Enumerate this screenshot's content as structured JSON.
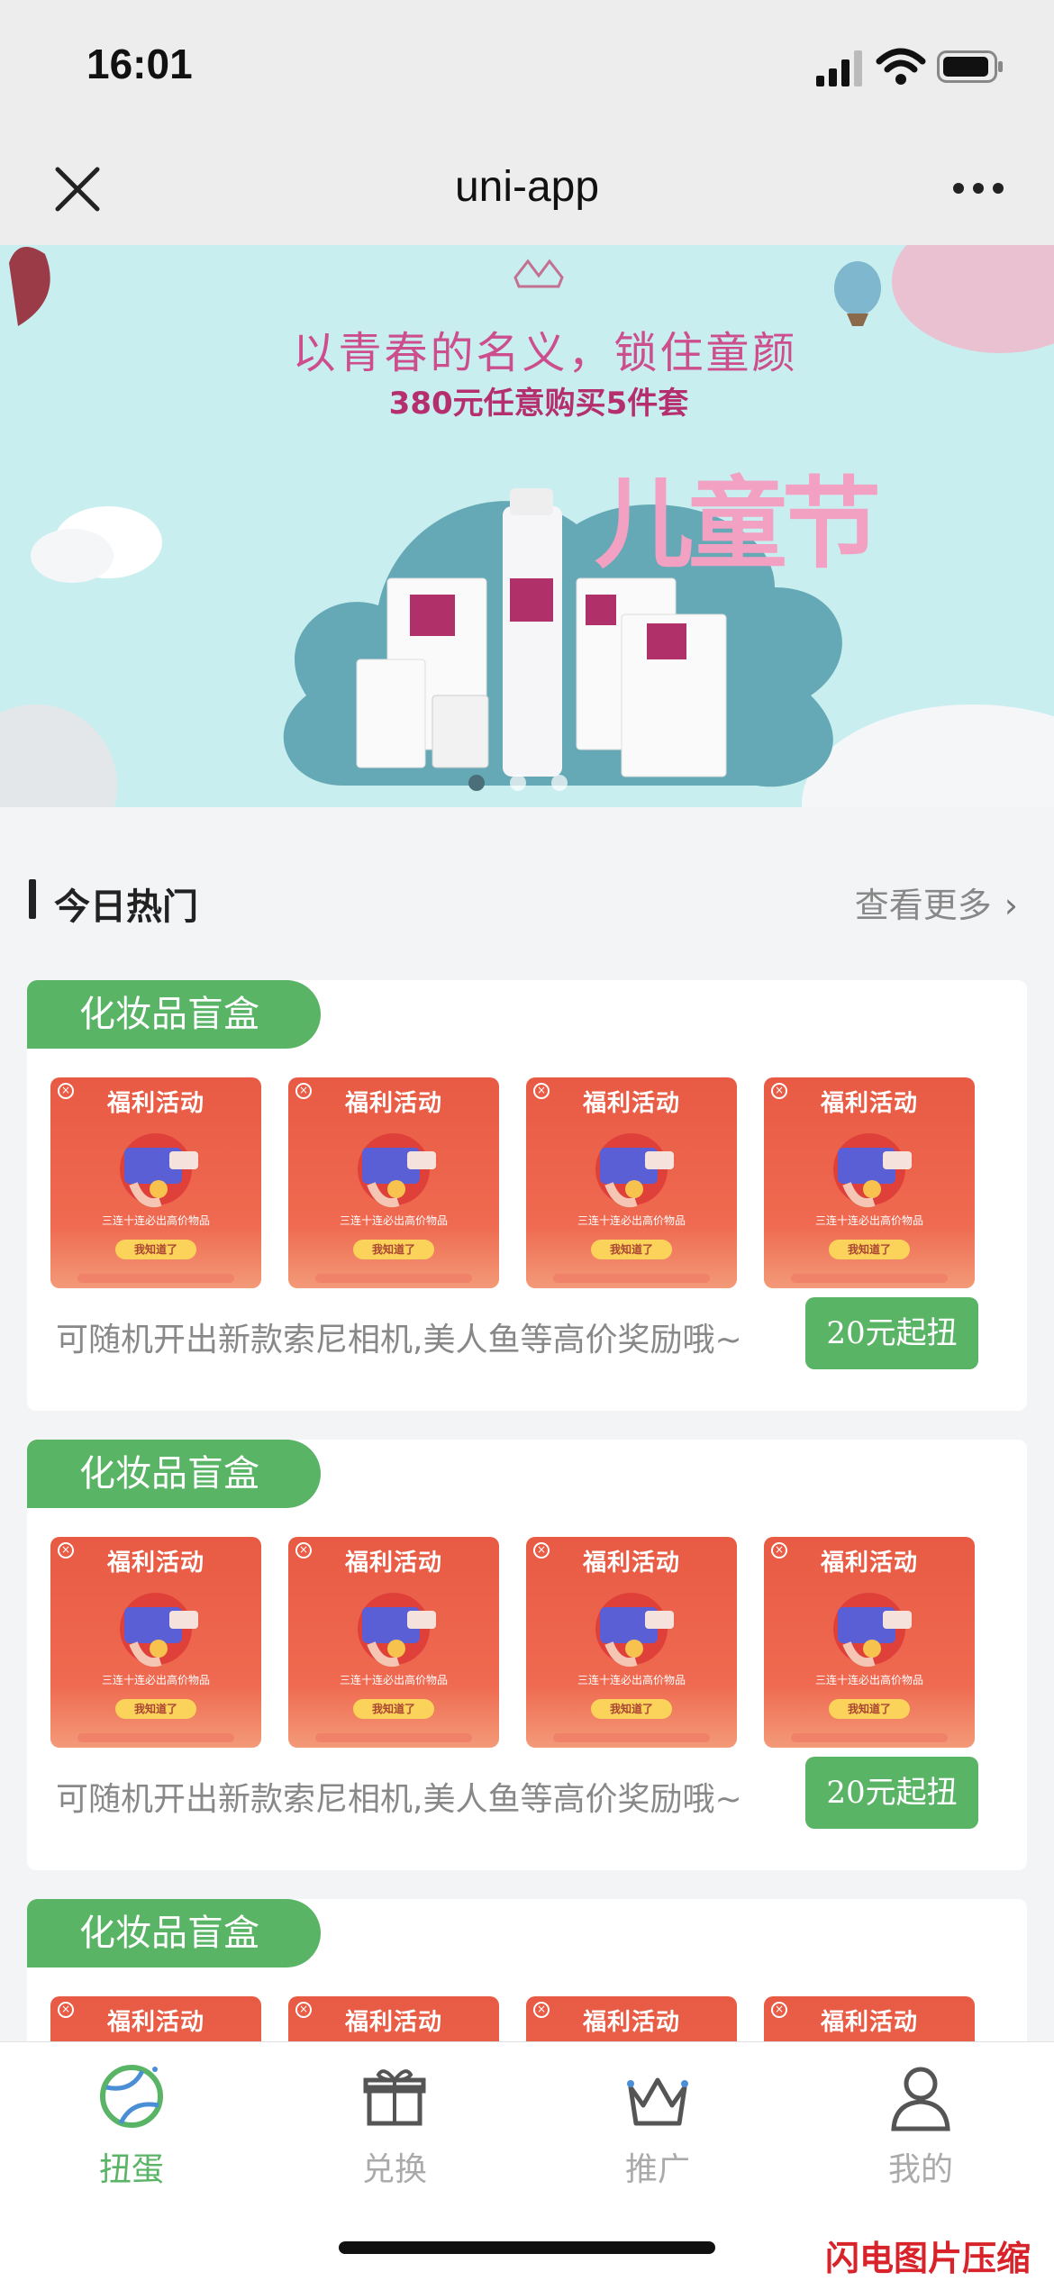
{
  "status": {
    "time": "16:01"
  },
  "nav": {
    "title": "uni-app"
  },
  "banner": {
    "title": "以青春的名义，锁住童颜",
    "subtitle": "380元任意购买5件套",
    "label": "儿童节"
  },
  "section": {
    "title": "今日热门",
    "more": "查看更多"
  },
  "thumb": {
    "title": "福利活动",
    "caption": "三连十连必出高价物品",
    "button": "我知道了"
  },
  "cards": [
    {
      "tag": "化妆品盲盒",
      "desc": "可随机开出新款索尼相机,美人鱼等高价奖励哦~",
      "button": "20元起扭"
    },
    {
      "tag": "化妆品盲盒",
      "desc": "可随机开出新款索尼相机,美人鱼等高价奖励哦~",
      "button": "20元起扭"
    },
    {
      "tag": "化妆品盲盒"
    }
  ],
  "tabs": [
    {
      "label": "扭蛋",
      "icon": "ball-icon",
      "active": true
    },
    {
      "label": "兑换",
      "icon": "gift-icon",
      "active": false
    },
    {
      "label": "推广",
      "icon": "crown-icon",
      "active": false
    },
    {
      "label": "我的",
      "icon": "user-icon",
      "active": false
    }
  ],
  "watermark": "闪电图片压缩器",
  "colors": {
    "accent": "#5ab466",
    "thumb": "#e85a44"
  }
}
